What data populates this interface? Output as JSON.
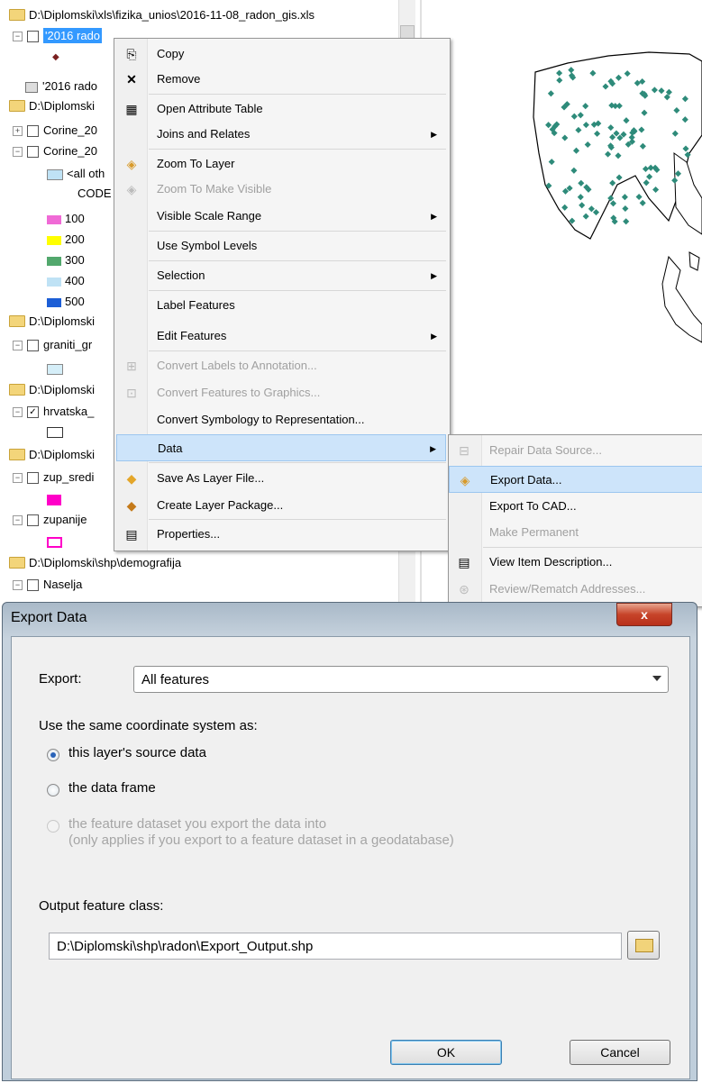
{
  "toc": {
    "rows": [
      {
        "type": "folder",
        "label": "D:\\Diplomski\\xls\\fizika_unios\\2016-11-08_radon_gis.xls"
      },
      {
        "type": "layer",
        "label": "'2016 rado",
        "selected": true
      },
      {
        "type": "table",
        "label": "'2016 rado"
      },
      {
        "type": "folder",
        "label": "D:\\Diplomski"
      },
      {
        "type": "layer",
        "label": "Corine_20"
      },
      {
        "type": "layer",
        "label": "Corine_20"
      },
      {
        "type": "legend",
        "label": "<all oth"
      },
      {
        "type": "heading",
        "label": "CODE"
      },
      {
        "type": "class",
        "label": "100",
        "color": "#f06ad6"
      },
      {
        "type": "class",
        "label": "200",
        "color": "#ffff00"
      },
      {
        "type": "class",
        "label": "300",
        "color": "#52a86d"
      },
      {
        "type": "class",
        "label": "400",
        "color": "#bfe2f5"
      },
      {
        "type": "class",
        "label": "500",
        "color": "#1c5ed6"
      },
      {
        "type": "folder",
        "label": "D:\\Diplomski"
      },
      {
        "type": "layer",
        "label": "graniti_gr"
      },
      {
        "type": "folder",
        "label": "D:\\Diplomski"
      },
      {
        "type": "layer",
        "label": "hrvatska_",
        "checked": true
      },
      {
        "type": "folder",
        "label": "D:\\Diplomski"
      },
      {
        "type": "layer",
        "label": "zup_sredi"
      },
      {
        "type": "layer",
        "label": "zupanije"
      },
      {
        "type": "folder",
        "label": "D:\\Diplomski\\shp\\demografija"
      },
      {
        "type": "layer",
        "label": "Naselja"
      }
    ]
  },
  "context_menu": {
    "items": [
      {
        "label": "Copy",
        "icon": "copy-icon"
      },
      {
        "label": "Remove",
        "icon": "remove-icon"
      },
      {
        "label": "Open Attribute Table",
        "icon": "attribute-table-icon"
      },
      {
        "label": "Joins and Relates",
        "submenu": true
      },
      {
        "label": "Zoom To Layer",
        "icon": "zoom-to-layer-icon"
      },
      {
        "label": "Zoom To Make Visible",
        "disabled": true,
        "icon": "zoom-visible-icon"
      },
      {
        "label": "Visible Scale Range",
        "submenu": true
      },
      {
        "label": "Use Symbol Levels"
      },
      {
        "label": "Selection",
        "submenu": true
      },
      {
        "label": "Label Features"
      },
      {
        "label": "Edit Features",
        "submenu": true
      },
      {
        "label": "Convert Labels to Annotation...",
        "disabled": true,
        "icon": "convert-labels-icon"
      },
      {
        "label": "Convert Features to Graphics...",
        "disabled": true,
        "icon": "convert-features-icon"
      },
      {
        "label": "Convert Symbology to Representation..."
      },
      {
        "label": "Data",
        "submenu": true,
        "highlight": true
      },
      {
        "label": "Save As Layer File...",
        "icon": "layer-file-icon"
      },
      {
        "label": "Create Layer Package...",
        "icon": "layer-package-icon"
      },
      {
        "label": "Properties...",
        "icon": "properties-icon"
      }
    ]
  },
  "submenu": {
    "items": [
      {
        "label": "Repair Data Source...",
        "disabled": true
      },
      {
        "label": "Export Data...",
        "highlight": true
      },
      {
        "label": "Export To CAD..."
      },
      {
        "label": "Make Permanent",
        "disabled": true
      },
      {
        "label": "View Item Description..."
      },
      {
        "label": "Review/Rematch Addresses...",
        "disabled": true
      }
    ]
  },
  "dialog": {
    "title": "Export Data",
    "close": "x",
    "export_label": "Export:",
    "export_value": "All features",
    "coord_heading": "Use the same coordinate system as:",
    "opt1": "this layer's source data",
    "opt2": "the data frame",
    "opt3_line1": "the feature dataset you export the data into",
    "opt3_line2": "(only applies if you export to a feature dataset in a geodatabase)",
    "output_label": "Output feature class:",
    "output_path": "D:\\Diplomski\\shp\\radon\\Export_Output.shp",
    "ok": "OK",
    "cancel": "Cancel"
  },
  "colors": {
    "highlight": "#cde4fa",
    "point_symbol": "#2e8b7a",
    "selection": "#3399ff"
  }
}
